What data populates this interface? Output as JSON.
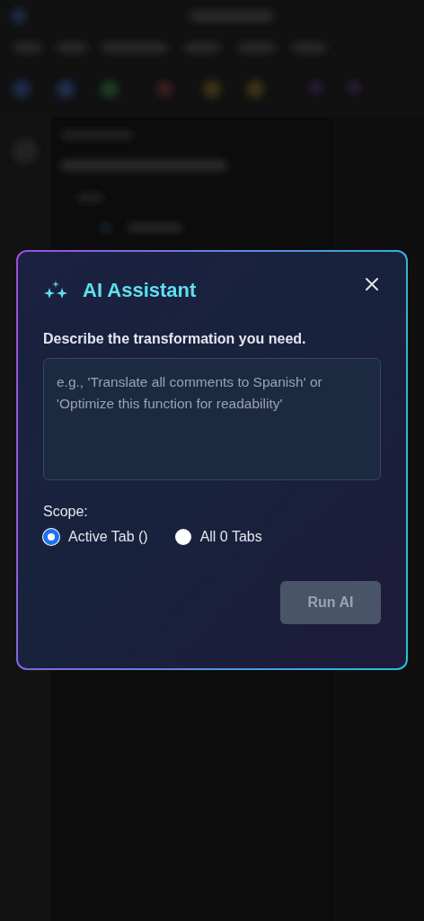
{
  "dialog": {
    "title": "AI Assistant",
    "prompt_label": "Describe the transformation you need.",
    "prompt": {
      "placeholder": "e.g., 'Translate all comments to Spanish' or 'Optimize this function for readability'"
    },
    "scope_label": "Scope:",
    "scope_options": [
      {
        "label": "Active Tab ()",
        "selected": true
      },
      {
        "label": "All 0 Tabs",
        "selected": false
      }
    ],
    "run_button": {
      "label": "Run AI",
      "disabled": true
    }
  }
}
